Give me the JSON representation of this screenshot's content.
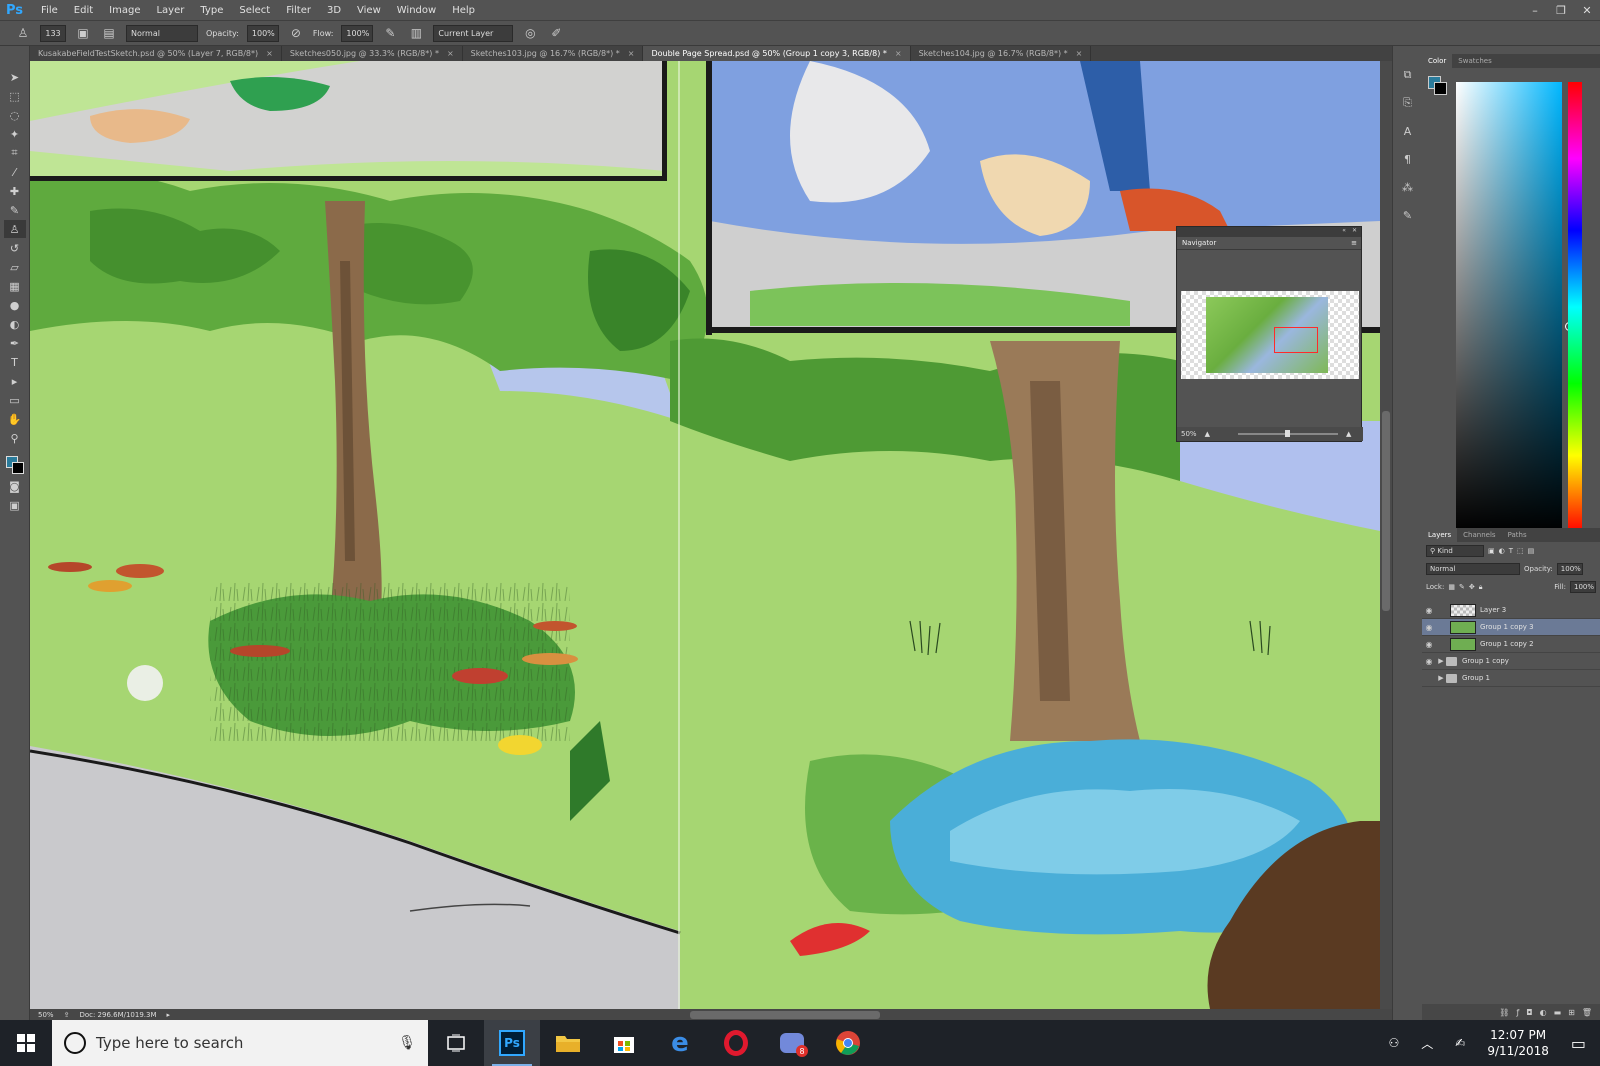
{
  "app": {
    "logo": "Ps",
    "menu": [
      "File",
      "Edit",
      "Image",
      "Layer",
      "Type",
      "Select",
      "Filter",
      "3D",
      "View",
      "Window",
      "Help"
    ],
    "window_controls": [
      "–",
      "❐",
      "✕"
    ]
  },
  "options_bar": {
    "brush_size": "133",
    "mode": "Normal",
    "opacity_label": "Opacity:",
    "opacity_value": "100%",
    "flow_label": "Flow:",
    "flow_value": "100%",
    "sample": "Current Layer"
  },
  "tabs": [
    {
      "label": "KusakabeFieldTestSketch.psd @ 50% (Layer 7, RGB/8*)",
      "active": false
    },
    {
      "label": "Sketches050.jpg @ 33.3% (RGB/8*) *",
      "active": false
    },
    {
      "label": "Sketches103.jpg @ 16.7% (RGB/8*) *",
      "active": false
    },
    {
      "label": "Double Page Spread.psd @ 50% (Group 1 copy 3, RGB/8) *",
      "active": true
    },
    {
      "label": "Sketches104.jpg @ 16.7% (RGB/8*) *",
      "active": false
    }
  ],
  "tab_close": "×",
  "status": {
    "zoom": "50%",
    "doc": "Doc: 296.6M/1019.3M"
  },
  "navigator": {
    "title": "Navigator",
    "zoom": "50%",
    "zoom_level": 0.5
  },
  "color_panel": {
    "tabs": [
      "Color",
      "Swatches"
    ],
    "foreground": "#2a7b9b",
    "background": "#000000"
  },
  "layers_panel": {
    "tabs": [
      "Layers",
      "Channels",
      "Paths"
    ],
    "kind": "Kind",
    "blend_mode": "Normal",
    "opacity_label": "Opacity:",
    "opacity_value": "100%",
    "lock_label": "Lock:",
    "fill_label": "Fill:",
    "fill_value": "100%",
    "layers": [
      {
        "name": "Layer 3",
        "visible": true,
        "type": "layer",
        "selected": false
      },
      {
        "name": "Group 1 copy 3",
        "visible": true,
        "type": "layer",
        "selected": true
      },
      {
        "name": "Group 1 copy 2",
        "visible": true,
        "type": "layer",
        "selected": false
      },
      {
        "name": "Group 1 copy",
        "visible": true,
        "type": "group",
        "selected": false
      },
      {
        "name": "Group 1",
        "visible": false,
        "type": "group",
        "selected": false
      }
    ]
  },
  "taskbar": {
    "search_placeholder": "Type here to search",
    "time": "12:07 PM",
    "date": "9/11/2018",
    "discord_badge": "8"
  }
}
